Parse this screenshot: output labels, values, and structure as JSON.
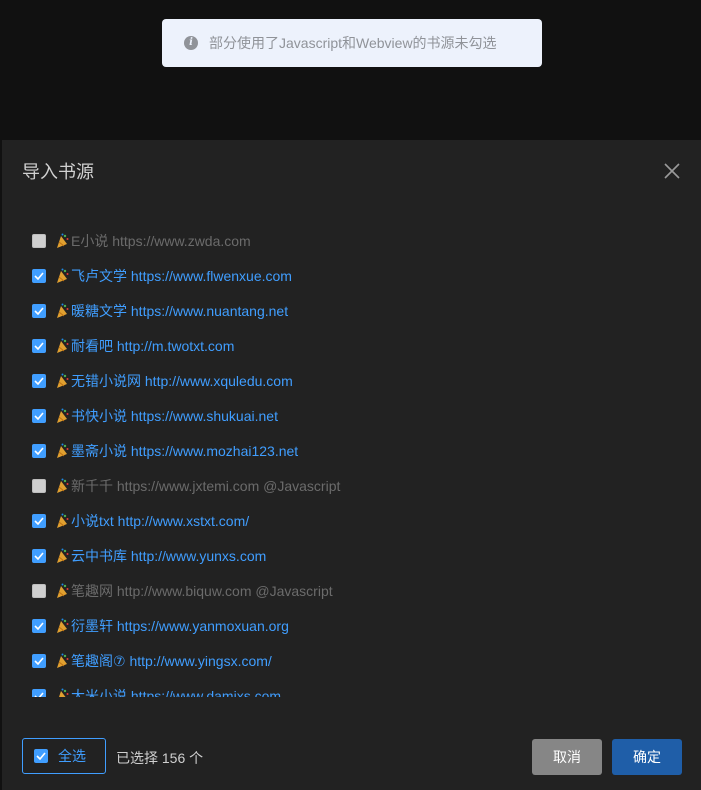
{
  "toast": {
    "icon": "info-icon",
    "icon_glyph": "i",
    "message": "部分使用了Javascript和Webview的书源未勾选"
  },
  "dialog": {
    "title": "导入书源",
    "close_icon": "close-icon",
    "items": [
      {
        "name": "E小说",
        "url": "https://www.zwda.com",
        "note": "",
        "checked": false
      },
      {
        "name": "飞卢文学",
        "url": "https://www.flwenxue.com",
        "note": "",
        "checked": true
      },
      {
        "name": "暖糖文学",
        "url": "https://www.nuantang.net",
        "note": "",
        "checked": true
      },
      {
        "name": "耐看吧",
        "url": "http://m.twotxt.com",
        "note": "",
        "checked": true
      },
      {
        "name": "无错小说网",
        "url": "http://www.xquledu.com",
        "note": "",
        "checked": true
      },
      {
        "name": "书快小说",
        "url": "https://www.shukuai.net",
        "note": "",
        "checked": true
      },
      {
        "name": "墨斋小说",
        "url": "https://www.mozhai123.net",
        "note": "",
        "checked": true
      },
      {
        "name": "新千千",
        "url": "https://www.jxtemi.com",
        "note": "@Javascript",
        "checked": false
      },
      {
        "name": "小说txt",
        "url": "http://www.xstxt.com/",
        "note": "",
        "checked": true
      },
      {
        "name": "云中书库",
        "url": "http://www.yunxs.com",
        "note": "",
        "checked": true
      },
      {
        "name": "笔趣网",
        "url": "http://www.biquw.com",
        "note": "@Javascript",
        "checked": false
      },
      {
        "name": "衍墨轩",
        "url": "https://www.yanmoxuan.org",
        "note": "",
        "checked": true
      },
      {
        "name": "笔趣阁⑦",
        "url": "http://www.yingsx.com/",
        "note": "",
        "checked": true
      },
      {
        "name": "大米小说",
        "url": "https://www.damixs.com",
        "note": "",
        "checked": true
      }
    ],
    "footer": {
      "select_all_label": "全选",
      "select_all_checked": true,
      "selected_count_text": "已选择 156 个",
      "cancel_label": "取消",
      "confirm_label": "确定"
    }
  },
  "colors": {
    "accent": "#409eff",
    "confirm_button": "#1f5ea8",
    "cancel_button": "#868686",
    "dialog_bg": "#222222",
    "backdrop": "#111111"
  }
}
